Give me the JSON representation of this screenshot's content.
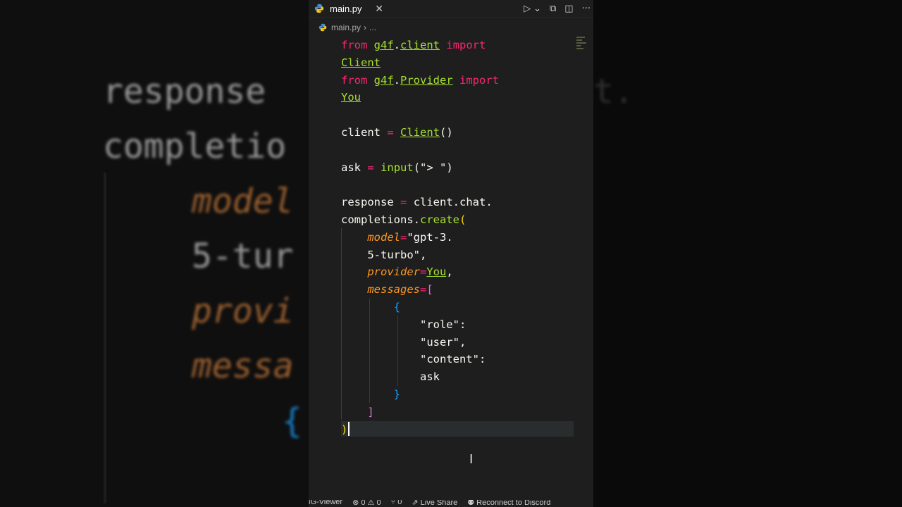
{
  "background": {
    "left_lines": [
      {
        "text": "response",
        "color": "#c8c8c8"
      },
      {
        "text": "completio",
        "color": "#c8c8c8"
      },
      {
        "text": "model",
        "color": "#c87a3a"
      },
      {
        "text": "5-tur",
        "color": "#c8c8c8"
      },
      {
        "text": "provi",
        "color": "#c87a3a"
      },
      {
        "text": "messa",
        "color": "#c87a3a"
      }
    ],
    "right_text": "t."
  },
  "tab": {
    "filename": "main.py",
    "close_glyph": "✕"
  },
  "toolbar": {
    "run_glyph": "▷",
    "chevron_glyph": "⌄",
    "split_glyph": "⧉",
    "layout_glyph": "◫",
    "more_glyph": "···"
  },
  "breadcrumb": {
    "file": "main.py",
    "separator": "›",
    "more": "..."
  },
  "code": {
    "l1_kw1": "from",
    "l1_mod": "g4f",
    "l1_dot": ".",
    "l1_sub": "client",
    "l1_kw2": "import",
    "l2_cls": "Client",
    "l3_kw1": "from",
    "l3_mod": "g4f",
    "l3_dot": ".",
    "l3_sub": "Provider",
    "l3_kw2": "import",
    "l4_cls": "You",
    "l6_var": "client",
    "l6_eq": "=",
    "l6_call": "Client",
    "l6_paren": "()",
    "l8_var": "ask",
    "l8_eq": "=",
    "l8_fn": "input",
    "l8_open": "(",
    "l8_str": "\"> \"",
    "l8_close": ")",
    "l10_var": "response",
    "l10_eq": "=",
    "l10_rest": "client.chat.",
    "l11_a": "completions.",
    "l11_fn": "create",
    "l11_paren": "(",
    "l12_param": "model",
    "l12_eq": "=",
    "l12_str": "\"gpt-3.",
    "l13_str": "5-turbo\"",
    "l13_comma": ",",
    "l14_param": "provider",
    "l14_eq": "=",
    "l14_cls": "You",
    "l14_comma": ",",
    "l15_param": "messages",
    "l15_eq": "=",
    "l15_br": "[",
    "l16_br": "{",
    "l17_str": "\"role\"",
    "l17_colon": ":",
    "l18_str": "\"user\"",
    "l18_comma": ",",
    "l19_str": "\"content\"",
    "l19_colon": ":",
    "l20_var": "ask",
    "l21_br": "}",
    "l22_br": "]",
    "l23_br": ")"
  },
  "statusbar": {
    "viewer": "iG-Viewer",
    "problems": "⊗ 0 ⚠ 0",
    "ports": "⑂ 0",
    "live_share": "⇗ Live Share",
    "discord": "⚉ Reconnect to Discord"
  },
  "colors": {
    "editor_bg": "#1e1e1e",
    "keyword": "#f92672",
    "class": "#a6e22e",
    "string": "#e6db74",
    "param": "#fd971f"
  }
}
